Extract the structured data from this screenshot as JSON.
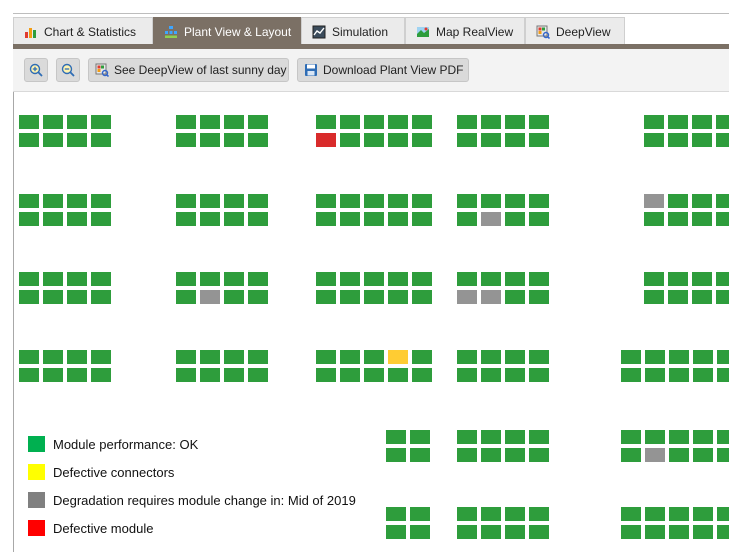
{
  "tabs": [
    {
      "label": "Chart & Statistics",
      "icon": "bar-chart-icon",
      "active": false
    },
    {
      "label": "Plant View & Layout",
      "icon": "plant-layout-icon",
      "active": true
    },
    {
      "label": "Simulation",
      "icon": "simulation-icon",
      "active": false
    },
    {
      "label": "Map RealView",
      "icon": "map-icon",
      "active": false
    },
    {
      "label": "DeepView",
      "icon": "deepview-icon",
      "active": false
    }
  ],
  "toolbar": {
    "zoom_in_icon": "zoom-in-icon",
    "zoom_out_icon": "zoom-out-icon",
    "deepview_label": "See DeepView of last sunny day",
    "download_label": "Download Plant View PDF"
  },
  "status_colors": {
    "ok": "#2e9d3c",
    "connectors": "#ffcc33",
    "degradation": "#949494",
    "defective": "#d92b2b"
  },
  "legend": [
    {
      "status": "ok",
      "label": "Module performance: OK",
      "color": "#00b050"
    },
    {
      "status": "connectors",
      "label": "Defective connectors",
      "color": "#ffff00"
    },
    {
      "status": "degradation",
      "label": "Degradation requires module change in: Mid of 2019",
      "color": "#808080"
    },
    {
      "status": "defective",
      "label": "Defective module",
      "color": "#ff0000"
    }
  ],
  "module_blocks": [
    {
      "cols": 4,
      "rows": 2,
      "special": {}
    },
    {
      "cols": 4,
      "rows": 2,
      "special": {}
    },
    {
      "cols": 5,
      "rows": 2,
      "special": {
        "1,0": "defective"
      }
    },
    {
      "cols": 4,
      "rows": 2,
      "special": {}
    },
    {
      "cols": 4,
      "rows": 2,
      "special": {}
    },
    {
      "cols": 4,
      "rows": 2,
      "special": {}
    },
    {
      "cols": 4,
      "rows": 2,
      "special": {}
    },
    {
      "cols": 5,
      "rows": 2,
      "special": {}
    },
    {
      "cols": 4,
      "rows": 2,
      "special": {
        "1,1": "degradation"
      }
    },
    {
      "cols": 4,
      "rows": 2,
      "special": {
        "0,0": "degradation"
      }
    },
    {
      "cols": 4,
      "rows": 2,
      "special": {}
    },
    {
      "cols": 4,
      "rows": 2,
      "special": {
        "1,1": "degradation"
      }
    },
    {
      "cols": 5,
      "rows": 2,
      "special": {}
    },
    {
      "cols": 4,
      "rows": 2,
      "special": {
        "1,0": "degradation",
        "1,1": "degradation"
      }
    },
    {
      "cols": 4,
      "rows": 2,
      "special": {}
    },
    {
      "cols": 4,
      "rows": 2,
      "special": {}
    },
    {
      "cols": 4,
      "rows": 2,
      "special": {}
    },
    {
      "cols": 5,
      "rows": 2,
      "special": {
        "0,3": "connectors"
      }
    },
    {
      "cols": 4,
      "rows": 2,
      "special": {}
    },
    {
      "cols": 5,
      "rows": 2,
      "special": {}
    },
    {
      "cols": 2,
      "rows": 2,
      "special": {}
    },
    {
      "cols": 4,
      "rows": 2,
      "special": {}
    },
    {
      "cols": 5,
      "rows": 2,
      "special": {
        "1,1": "degradation"
      }
    },
    {
      "cols": 2,
      "rows": 2,
      "special": {}
    },
    {
      "cols": 4,
      "rows": 2,
      "special": {}
    },
    {
      "cols": 5,
      "rows": 2,
      "special": {}
    }
  ]
}
